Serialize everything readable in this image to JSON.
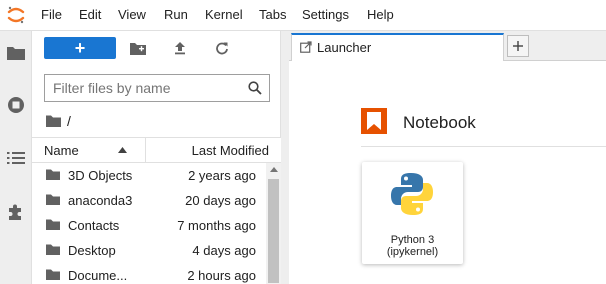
{
  "menubar": {
    "items": [
      "File",
      "Edit",
      "View",
      "Run",
      "Kernel",
      "Tabs",
      "Settings",
      "Help"
    ]
  },
  "sidebar": {
    "icons": [
      "folder-icon",
      "running-icon",
      "toc-icon",
      "extension-icon"
    ]
  },
  "filebrowser": {
    "new_label": "+",
    "filter": {
      "placeholder": "Filter files by name",
      "value": ""
    },
    "breadcrumb": "/",
    "columns": {
      "name": "Name",
      "modified": "Last Modified"
    },
    "files": [
      {
        "name": "3D Objects",
        "modified": "2 years ago"
      },
      {
        "name": "anaconda3",
        "modified": "20 days ago"
      },
      {
        "name": "Contacts",
        "modified": "7 months ago"
      },
      {
        "name": "Desktop",
        "modified": "4 days ago"
      },
      {
        "name": "Docume...",
        "modified": "2 hours ago"
      }
    ]
  },
  "tabs": [
    {
      "label": "Launcher",
      "active": true
    }
  ],
  "launcher": {
    "section_title": "Notebook",
    "kernel": {
      "line1": "Python 3",
      "line2": "(ipykernel)"
    }
  },
  "colors": {
    "accent": "#1976d2",
    "notebook_icon": "#e65100",
    "jupyter_logo": "#f37626"
  }
}
